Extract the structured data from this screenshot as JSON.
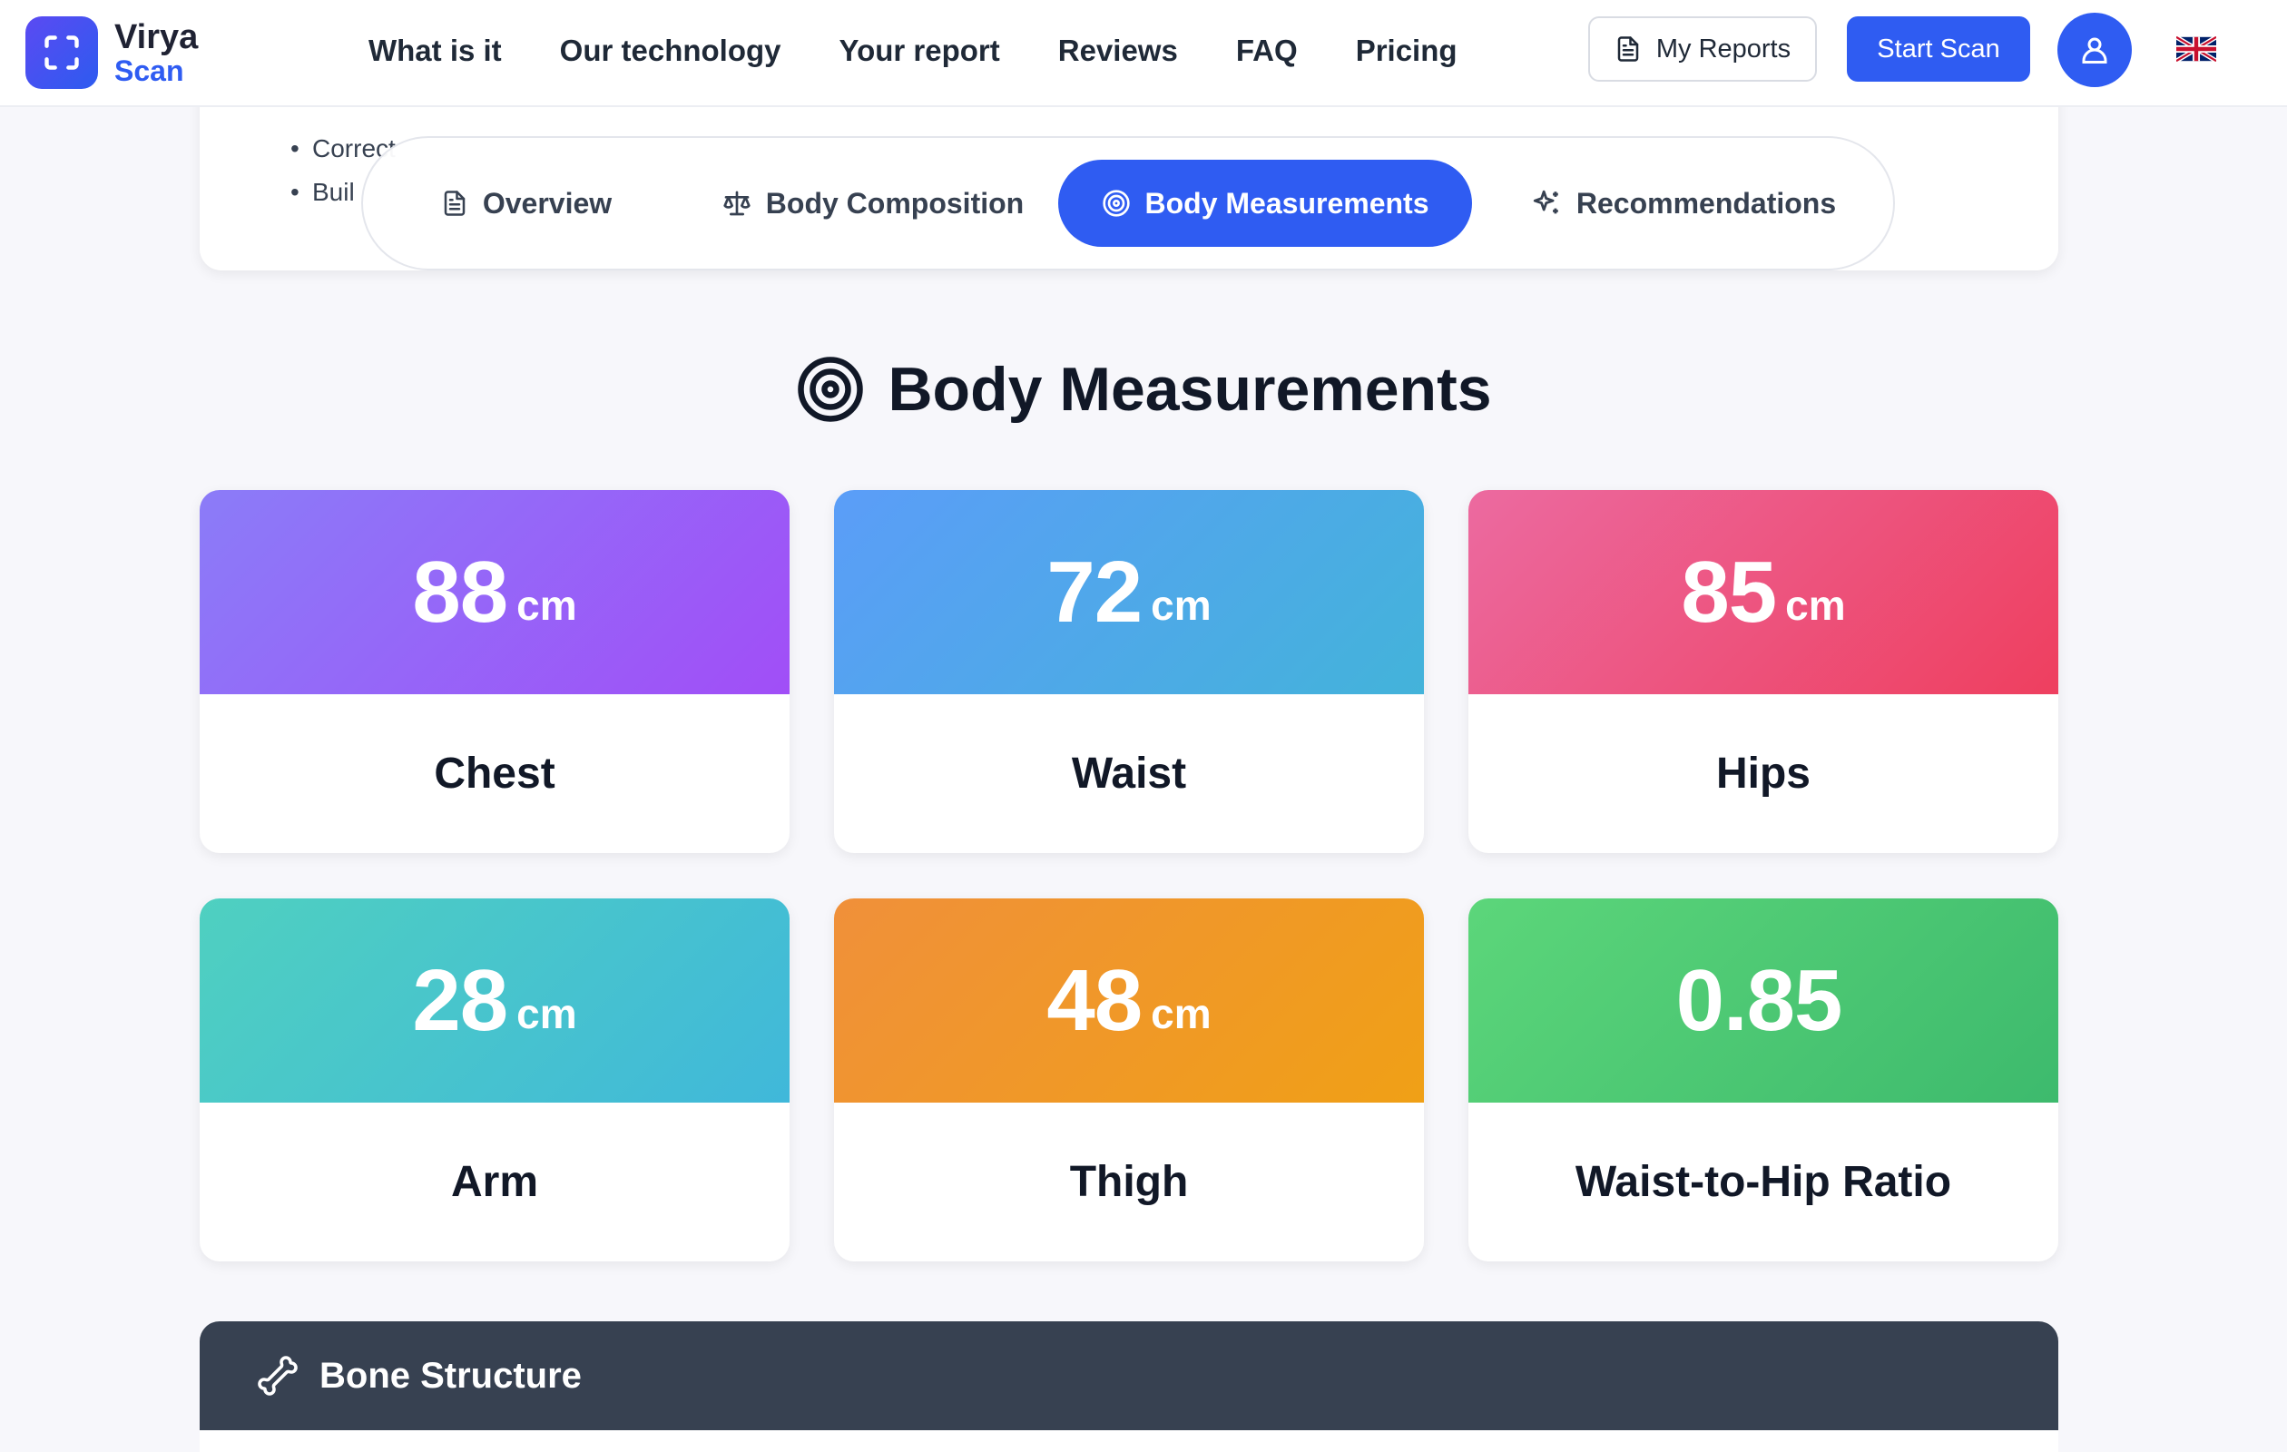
{
  "brand": {
    "name": "Virya",
    "sub": "Scan"
  },
  "nav": [
    "What is it",
    "Our technology",
    "Your report",
    "Reviews",
    "FAQ",
    "Pricing"
  ],
  "header": {
    "my_reports": "My Reports",
    "start_scan": "Start Scan"
  },
  "prev_card": {
    "items": [
      "Correct",
      "Buil"
    ]
  },
  "tabs": [
    {
      "label": "Overview",
      "icon": "document-icon",
      "active": false
    },
    {
      "label": "Body Composition",
      "icon": "scale-icon",
      "active": false
    },
    {
      "label": "Body Measurements",
      "icon": "target-icon",
      "active": true
    },
    {
      "label": "Recommendations",
      "icon": "sparkles-icon",
      "active": false
    }
  ],
  "section": {
    "title": "Body Measurements"
  },
  "measurements": [
    {
      "value": "88",
      "unit": "cm",
      "label": "Chest",
      "colors": [
        "#8b7cf8",
        "#a14ef7"
      ]
    },
    {
      "value": "72",
      "unit": "cm",
      "label": "Waist",
      "colors": [
        "#5b9df8",
        "#43b3da"
      ]
    },
    {
      "value": "85",
      "unit": "cm",
      "label": "Hips",
      "colors": [
        "#ec6aa0",
        "#ee3f5f"
      ]
    },
    {
      "value": "28",
      "unit": "cm",
      "label": "Arm",
      "colors": [
        "#4fd0c0",
        "#40b8da"
      ]
    },
    {
      "value": "48",
      "unit": "cm",
      "label": "Thigh",
      "colors": [
        "#f0903a",
        "#f0a016"
      ]
    },
    {
      "value": "0.85",
      "unit": "",
      "label": "Waist-to-Hip Ratio",
      "colors": [
        "#5cd67a",
        "#3dba6d"
      ]
    }
  ],
  "bone": {
    "title": "Bone Structure"
  },
  "colors": {
    "primary": "#2f5cf2",
    "dark_header": "#374151"
  }
}
